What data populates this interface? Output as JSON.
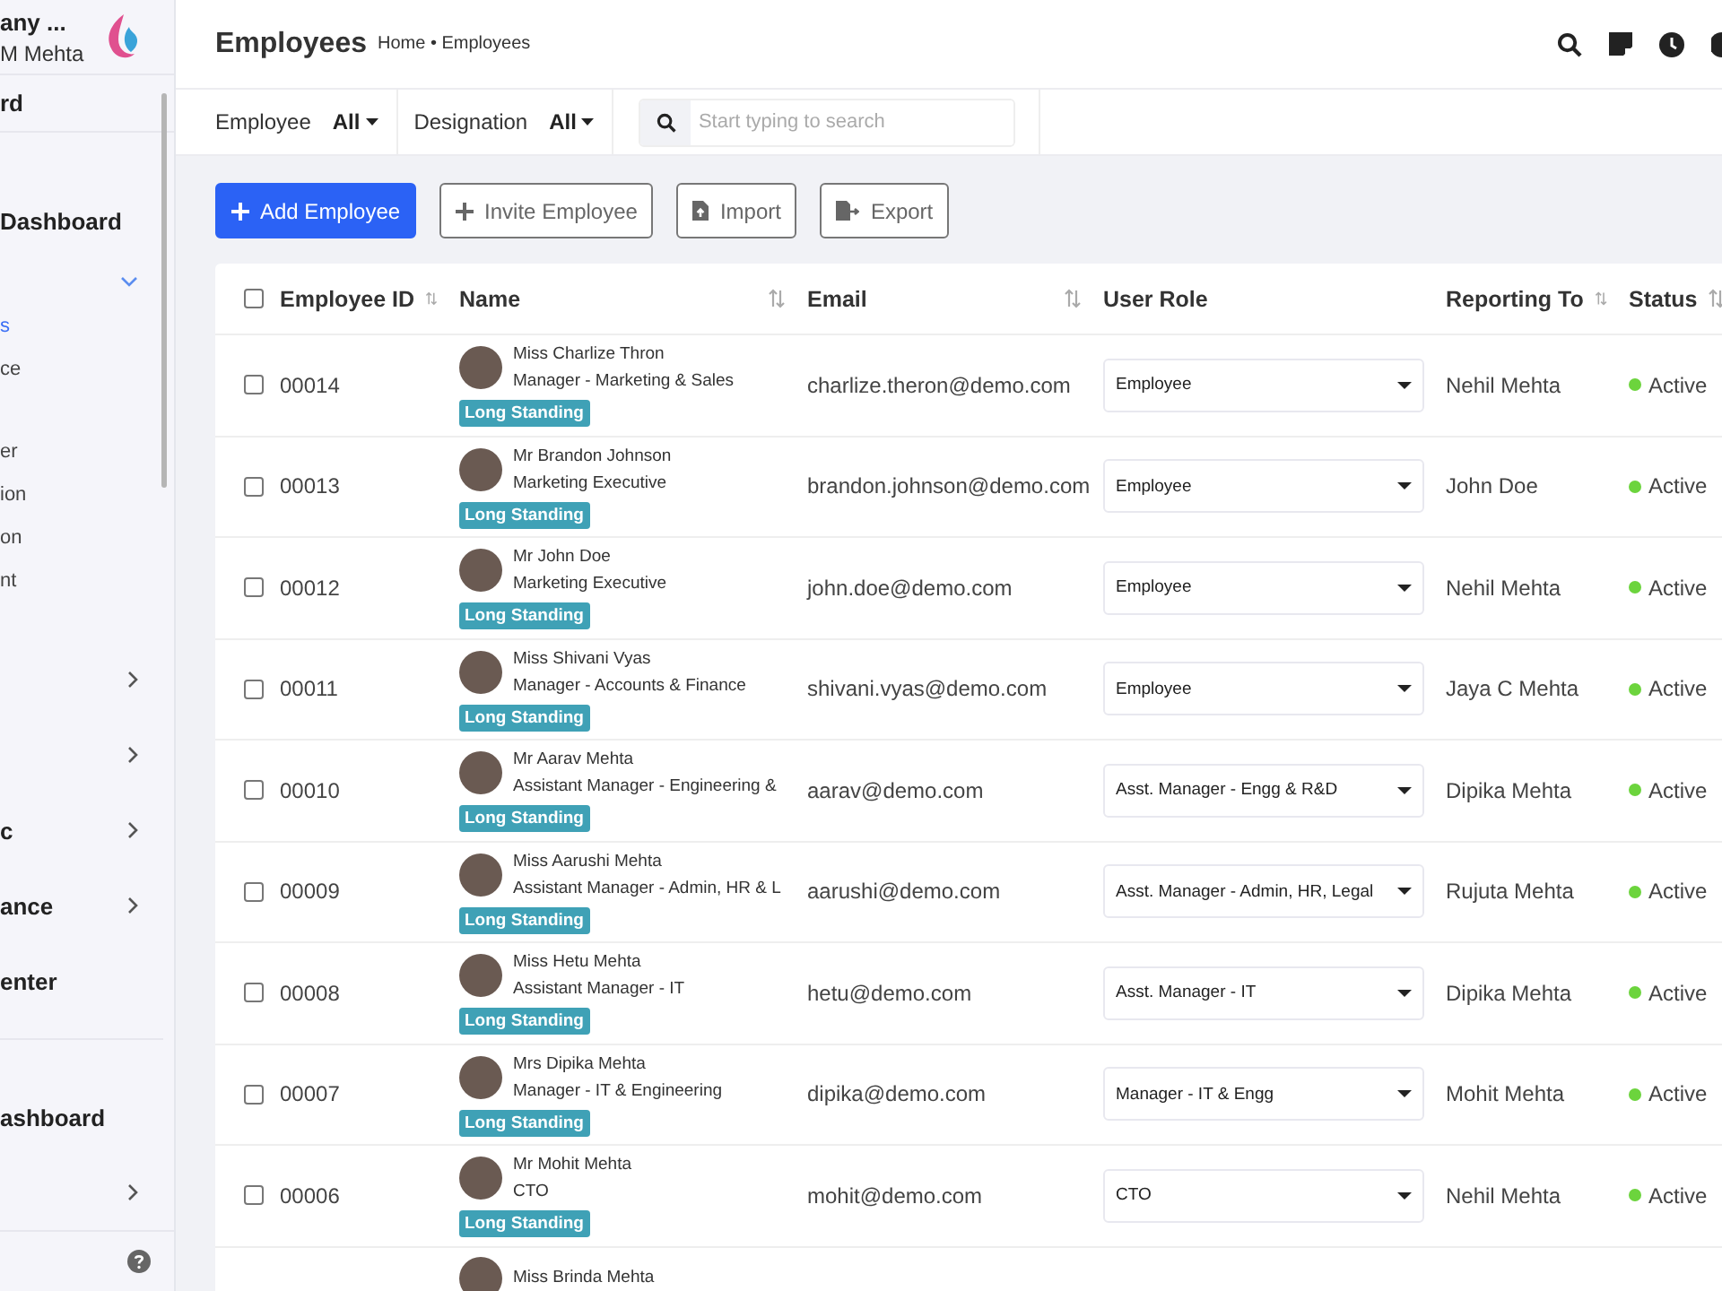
{
  "sidebar": {
    "company": "any ...",
    "user": "M Mehta",
    "section": "rd",
    "items": [
      {
        "kind": "main",
        "label": "Dashboard",
        "selected": false
      },
      {
        "kind": "group",
        "expanded": true
      },
      {
        "kind": "sub",
        "label": "s",
        "selected": true
      },
      {
        "kind": "sub",
        "label": "ce",
        "selected": false
      },
      {
        "kind": "gap"
      },
      {
        "kind": "sub",
        "label": "er",
        "selected": false
      },
      {
        "kind": "sub",
        "label": "ion",
        "selected": false
      },
      {
        "kind": "sub",
        "label": "on",
        "selected": false
      },
      {
        "kind": "sub",
        "label": "nt",
        "selected": false
      },
      {
        "kind": "gap"
      },
      {
        "kind": "main",
        "expanded": false
      },
      {
        "kind": "main",
        "expanded": false
      },
      {
        "kind": "main",
        "label": "c",
        "expanded": false,
        "selected": false
      },
      {
        "kind": "main",
        "label": "ance",
        "expanded": false,
        "selected": false
      },
      {
        "kind": "main",
        "label": "enter",
        "selected": false
      },
      {
        "kind": "rule"
      },
      {
        "kind": "gap"
      },
      {
        "kind": "main",
        "label": "ashboard",
        "selected": false
      },
      {
        "kind": "main",
        "expanded": false
      }
    ]
  },
  "header": {
    "title": "Employees",
    "breadcrumb": "Home • Employees"
  },
  "filters": [
    {
      "label": "Employee",
      "value": "All"
    },
    {
      "label": "Designation",
      "value": "All"
    }
  ],
  "search": {
    "placeholder": "Start typing to search"
  },
  "actions": [
    {
      "label": "Add Employee",
      "kind": "primary"
    },
    {
      "label": "Invite Employee",
      "kind": "invite"
    },
    {
      "label": "Import",
      "kind": "import"
    },
    {
      "label": "Export",
      "kind": "export"
    }
  ],
  "table": {
    "select_all_checked": false,
    "columns": [
      {
        "label": "Employee ID",
        "sortable": true
      },
      {
        "label": "Name",
        "sortable": true
      },
      {
        "label": "Email",
        "sortable": true
      },
      {
        "label": "User Role",
        "sortable": false
      },
      {
        "label": "Reporting To",
        "sortable": true
      },
      {
        "label": "Status",
        "sortable": true
      }
    ],
    "rows": [
      {
        "checked": false,
        "id": "00014",
        "name": "Miss Charlize Thron",
        "title": "Manager - Marketing & Sales",
        "badge": "Long Standing",
        "email": "charlize.theron@demo.com",
        "role": "Employee",
        "reporting_to": "Nehil Mehta",
        "status": "Active",
        "color": "#6cd43d"
      },
      {
        "checked": false,
        "id": "00013",
        "name": "Mr Brandon Johnson",
        "title": "Marketing Executive",
        "badge": "Long Standing",
        "email": "brandon.johnson@demo.com",
        "role": "Employee",
        "reporting_to": "John Doe",
        "status": "Active",
        "color": "#6cd43d"
      },
      {
        "checked": false,
        "id": "00012",
        "name": "Mr John Doe",
        "title": "Marketing Executive",
        "badge": "Long Standing",
        "email": "john.doe@demo.com",
        "role": "Employee",
        "reporting_to": "Nehil Mehta",
        "status": "Active",
        "color": "#6cd43d"
      },
      {
        "checked": false,
        "id": "00011",
        "name": "Miss Shivani Vyas",
        "title": "Manager - Accounts & Finance",
        "badge": "Long Standing",
        "email": "shivani.vyas@demo.com",
        "role": "Employee",
        "reporting_to": "Jaya C Mehta",
        "status": "Active",
        "color": "#6cd43d"
      },
      {
        "checked": false,
        "id": "00010",
        "name": "Mr Aarav Mehta",
        "title": "Assistant Manager - Engineering &",
        "badge": "Long Standing",
        "email": "aarav@demo.com",
        "role": "Asst. Manager - Engg & R&D",
        "reporting_to": "Dipika Mehta",
        "status": "Active",
        "color": "#6cd43d"
      },
      {
        "checked": false,
        "id": "00009",
        "name": "Miss Aarushi Mehta",
        "title": "Assistant Manager - Admin, HR & L",
        "badge": "Long Standing",
        "email": "aarushi@demo.com",
        "role": "Asst. Manager - Admin, HR, Legal",
        "reporting_to": "Rujuta Mehta",
        "status": "Active",
        "color": "#6cd43d"
      },
      {
        "checked": false,
        "id": "00008",
        "name": "Miss Hetu Mehta",
        "title": "Assistant Manager - IT",
        "badge": "Long Standing",
        "email": "hetu@demo.com",
        "role": "Asst. Manager - IT",
        "reporting_to": "Dipika Mehta",
        "status": "Active",
        "color": "#6cd43d"
      },
      {
        "checked": false,
        "id": "00007",
        "name": "Mrs Dipika Mehta",
        "title": "Manager - IT & Engineering",
        "badge": "Long Standing",
        "email": "dipika@demo.com",
        "role": "Manager - IT & Engg",
        "reporting_to": "Mohit Mehta",
        "status": "Active",
        "color": "#6cd43d"
      },
      {
        "checked": false,
        "id": "00006",
        "name": "Mr Mohit Mehta",
        "title": "CTO",
        "badge": "Long Standing",
        "email": "mohit@demo.com",
        "role": "CTO",
        "reporting_to": "Nehil Mehta",
        "status": "Active",
        "color": "#6cd43d"
      },
      {
        "name": "Miss Brinda Mehta"
      }
    ]
  }
}
